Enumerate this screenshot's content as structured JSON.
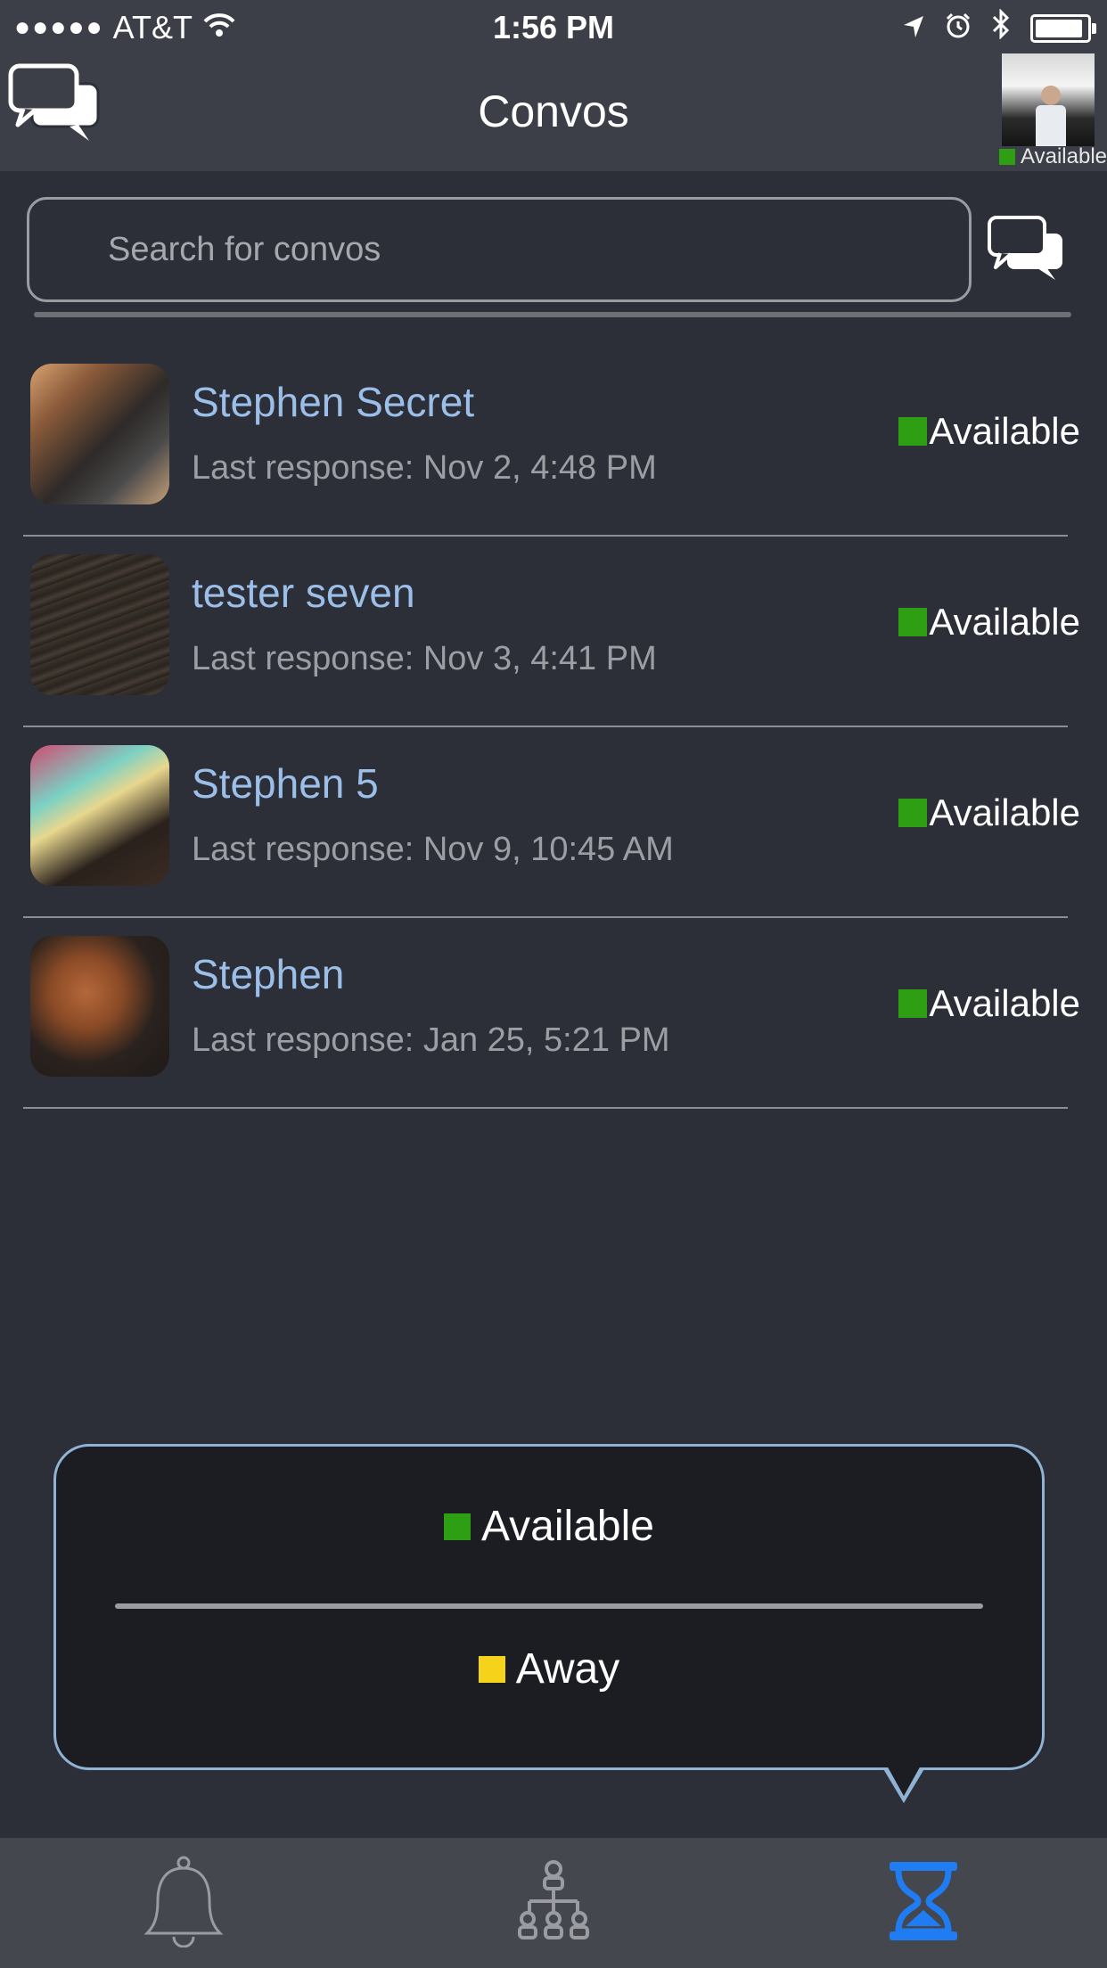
{
  "status_bar": {
    "signal_dots": "●●●●●",
    "carrier": "AT&T",
    "time": "1:56 PM"
  },
  "nav": {
    "title": "Convos",
    "user_status": "Available"
  },
  "search": {
    "placeholder": "Search for convos"
  },
  "convos": [
    {
      "name": "Stephen Secret",
      "last_response": "Last response: Nov 2, 4:48 PM",
      "status": "Available"
    },
    {
      "name": "tester seven",
      "last_response": "Last response: Nov 3, 4:41 PM",
      "status": "Available"
    },
    {
      "name": "Stephen 5",
      "last_response": "Last response: Nov 9, 10:45 AM",
      "status": "Available"
    },
    {
      "name": "Stephen",
      "last_response": "Last response: Jan 25, 5:21 PM",
      "status": "Available"
    }
  ],
  "status_popover": {
    "options": [
      {
        "label": "Available",
        "color": "#2e9e12"
      },
      {
        "label": "Away",
        "color": "#f5d31a"
      }
    ]
  },
  "tab_bar": {
    "tabs": [
      {
        "icon": "bell-icon"
      },
      {
        "icon": "network-icon"
      },
      {
        "icon": "hourglass-icon",
        "active": true
      }
    ],
    "active_color": "#1f7cf2",
    "inactive_color": "#9a9ca2"
  },
  "colors": {
    "available": "#2e9e12",
    "away": "#f5d31a",
    "name_text": "#9bbfe8"
  }
}
